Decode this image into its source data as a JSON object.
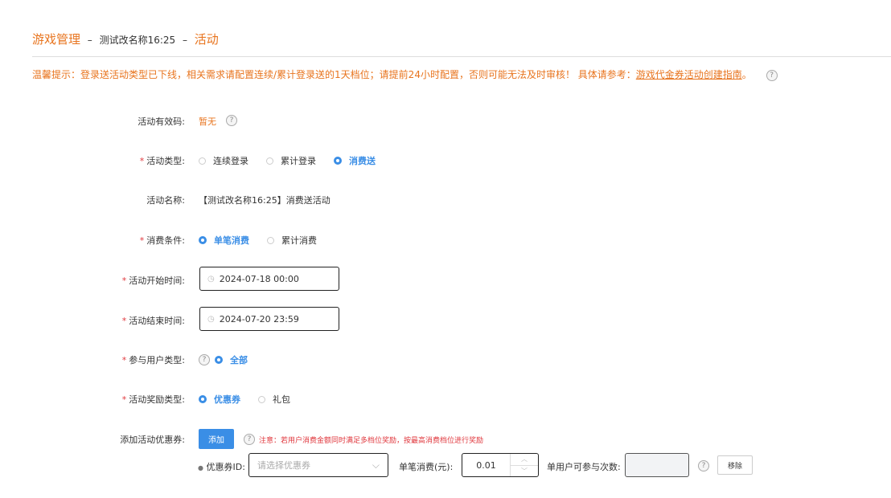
{
  "header": {
    "title": "游戏管理",
    "separator": "–",
    "game_name": "测试改名称16:25",
    "section": "活动"
  },
  "tip": {
    "prefix": "温馨提示：登录送活动类型已下线，相关需求请配置连续/累计登录送的1天档位；请提前24小时配置，否则可能无法及时审核！ 具体请参考：",
    "link": "游戏代金券活动创建指南",
    "suffix": "。",
    "help_icon": "?"
  },
  "form": {
    "code": {
      "label": "活动有效码:",
      "value": "暂无",
      "help_icon": "?"
    },
    "type": {
      "required": "*",
      "label": "活动类型:",
      "options": [
        "连续登录",
        "累计登录",
        "消费送"
      ],
      "selected": "消费送"
    },
    "name": {
      "label": "活动名称:",
      "value": "【测试改名称16:25】消费送活动"
    },
    "condition": {
      "required": "*",
      "label": "消费条件:",
      "options": [
        "单笔消费",
        "累计消费"
      ],
      "selected": "单笔消费"
    },
    "start": {
      "required": "*",
      "label": "活动开始时间:",
      "value": "2024-07-18 00:00",
      "icon": "◷"
    },
    "end": {
      "required": "*",
      "label": "活动结束时间:",
      "value": "2024-07-20 23:59",
      "icon": "◷"
    },
    "user_type": {
      "required": "*",
      "label": "参与用户类型:",
      "help_icon": "?",
      "options": [
        "全部"
      ],
      "selected": "全部"
    },
    "reward_type": {
      "required": "*",
      "label": "活动奖励类型:",
      "options": [
        "优惠券",
        "礼包"
      ],
      "selected": "优惠券"
    },
    "coupon": {
      "label": "添加活动优惠券:",
      "add_button": "添加",
      "help_icon": "?",
      "note": "注意：若用户消费金额同时满足多档位奖励，按最高消费档位进行奖励",
      "bullet": "●",
      "id_label": "优惠券ID:",
      "id_placeholder": "请选择优惠券",
      "chevron": "⌵",
      "amount_label": "单笔消费(元):",
      "amount_value": "0.01",
      "step_up": "︿",
      "step_down": "﹀",
      "times_label": "单用户可参与次数:",
      "times_help_icon": "?",
      "remove_button": "移除"
    }
  }
}
